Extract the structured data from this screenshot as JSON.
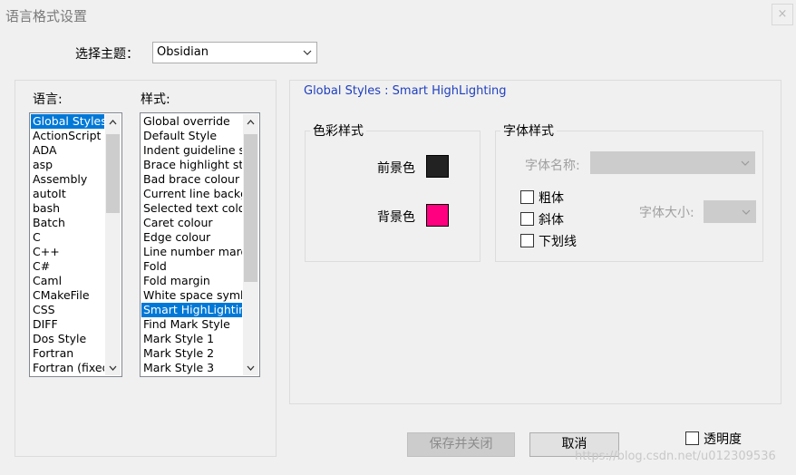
{
  "window": {
    "title": "语言格式设置",
    "close_glyph": "×"
  },
  "theme": {
    "label": "选择主题：",
    "selected": "Obsidian"
  },
  "language": {
    "label": "语言:",
    "items": [
      "Global Styles",
      "ActionScript",
      "ADA",
      "asp",
      "Assembly",
      "autoIt",
      "bash",
      "Batch",
      "C",
      "C++",
      "C#",
      "Caml",
      "CMakeFile",
      "CSS",
      "DIFF",
      "Dos Style",
      "Fortran",
      "Fortran (fixed"
    ],
    "selected_index": 0
  },
  "style": {
    "label": "样式:",
    "items": [
      "Global override",
      "Default Style",
      "Indent guideline st",
      "Brace highlight styl",
      "Bad brace colour",
      "Current line backgr",
      "Selected text colou",
      "Caret colour",
      "Edge colour",
      "Line number marg",
      "Fold",
      "Fold margin",
      "White space symbo",
      "Smart HighLighting",
      "Find Mark Style",
      "Mark Style 1",
      "Mark Style 2",
      "Mark Style 3"
    ],
    "selected_index": 13
  },
  "detail": {
    "title": "Global Styles : Smart HighLighting",
    "color_group": {
      "legend": "色彩样式",
      "fg_label": "前景色",
      "bg_label": "背景色",
      "fg_color": "#222222",
      "bg_color": "#ff0080"
    },
    "font_group": {
      "legend": "字体样式",
      "name_label": "字体名称:",
      "size_label": "字体大小:",
      "bold_label": "粗体",
      "italic_label": "斜体",
      "underline_label": "下划线"
    }
  },
  "buttons": {
    "save_close": "保存并关闭",
    "cancel": "取消"
  },
  "transparency": {
    "label": "透明度"
  },
  "watermark": "https://blog.csdn.net/u012309536"
}
